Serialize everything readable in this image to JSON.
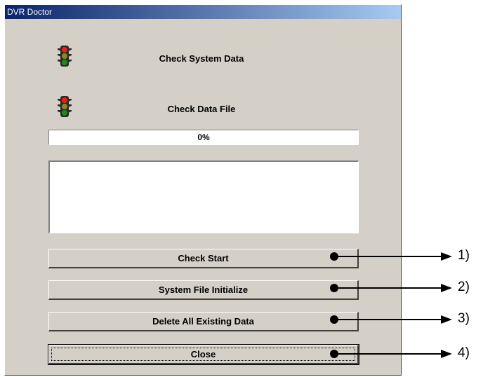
{
  "window": {
    "title": "DVR Doctor"
  },
  "checks": [
    {
      "label": "Check System Data",
      "icon": "traffic-light-icon"
    },
    {
      "label": "Check Data File",
      "icon": "traffic-light-icon"
    }
  ],
  "progress": {
    "text": "0%",
    "value": 0
  },
  "buttons": {
    "check_start": "Check Start",
    "system_file_initialize": "System File Initialize",
    "delete_all": "Delete All Existing Data",
    "close": "Close"
  },
  "annotations": [
    "1)",
    "2)",
    "3)",
    "4)"
  ]
}
